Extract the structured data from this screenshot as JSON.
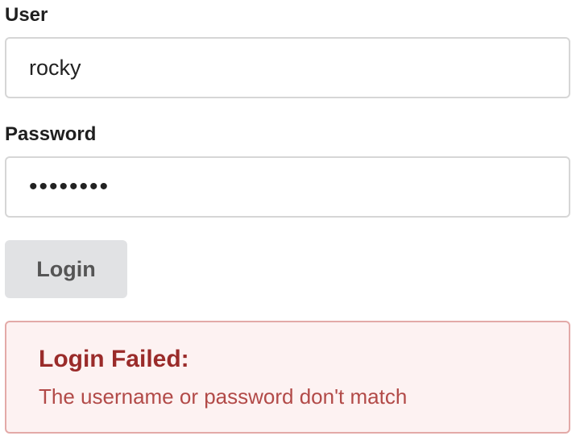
{
  "form": {
    "user_label": "User",
    "user_value": "rocky",
    "password_label": "Password",
    "password_value": "********",
    "login_button": "Login"
  },
  "alert": {
    "title": "Login Failed:",
    "message": "The username or password don't match",
    "colors": {
      "border": "#e3aaa8",
      "background": "#fdf2f2",
      "title": "#9a2b2a",
      "message": "#b24a48"
    }
  }
}
